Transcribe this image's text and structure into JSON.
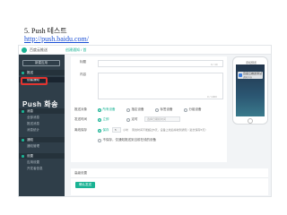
{
  "caption": {
    "title": "5. Push 테스트",
    "url": "http://push.baidu.com/"
  },
  "topbar": {
    "brand": "百度云推送",
    "breadcrumb": "创建通知 / 首"
  },
  "sidebar": {
    "top_button": "新建应用",
    "groups": [
      {
        "label": "推送",
        "items": [
          "创建通知"
        ]
      },
      {
        "label": "消息",
        "items": [
          "全部消息",
          "推送消息",
          "消息统计"
        ]
      },
      {
        "label": "通知",
        "items": [
          "通知管理"
        ]
      },
      {
        "label": "设置",
        "items": [
          "应用设置",
          "开发者信息"
        ]
      }
    ],
    "annotation": "Push 화송"
  },
  "form": {
    "title_label": "标题",
    "title_counter": "0 / 40",
    "content_label": "内容",
    "content_counter": "0 / 1000",
    "target_label": "推送对象",
    "target_options": [
      "所有设备",
      "指定设备",
      "标签设备",
      "分组设备"
    ],
    "send_label": "发送时间",
    "send_options": [
      "立即",
      "定时"
    ],
    "send_time_placeholder": "选择日期和时间",
    "expiry_label": "离线保存",
    "expiry_option": "保存",
    "expiry_value": "5",
    "expiry_unit": "小时",
    "expiry_note": "离线时间不能超过5天，设备上线后将收到通知（最长保存5天）",
    "footer_note": "不保存，仅通知推送到当前在线的设备"
  },
  "phone": {
    "title": "手机预览",
    "notice_title": "百度云推送测试",
    "notice_sub": "通知内容"
  },
  "bottom": {
    "title": "高级设置",
    "confirm": "确认发送"
  },
  "colors": {
    "accent": "#1ab394",
    "sidebar": "#2f3e49",
    "highlight": "#e3342f"
  }
}
